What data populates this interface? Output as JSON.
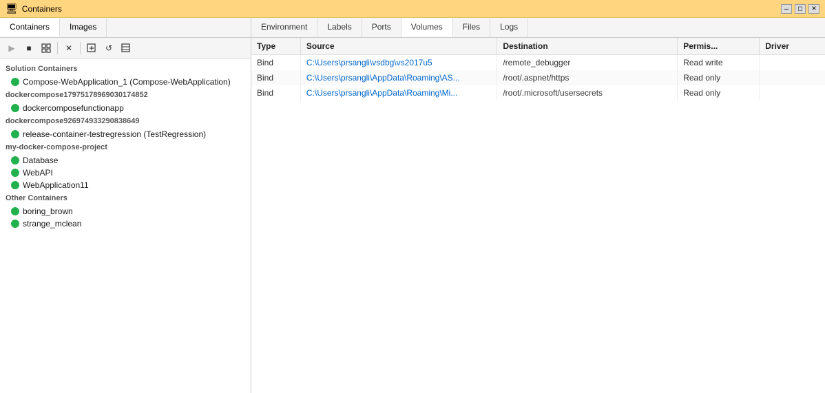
{
  "titleBar": {
    "title": "Containers",
    "controls": [
      "minimize",
      "restore",
      "close"
    ]
  },
  "leftPanel": {
    "tabs": [
      {
        "label": "Containers",
        "active": true
      },
      {
        "label": "Images",
        "active": false
      }
    ],
    "toolbar": {
      "buttons": [
        {
          "name": "play",
          "icon": "▶",
          "disabled": true
        },
        {
          "name": "stop",
          "icon": "■",
          "disabled": false
        },
        {
          "name": "attach",
          "icon": "⊞",
          "disabled": false
        },
        {
          "name": "delete",
          "icon": "✕",
          "disabled": false
        },
        {
          "name": "new",
          "icon": "⊡",
          "disabled": false
        },
        {
          "name": "refresh",
          "icon": "↺",
          "disabled": false
        },
        {
          "name": "more",
          "icon": "⊟",
          "disabled": false
        }
      ]
    },
    "groups": [
      {
        "name": "Solution Containers",
        "items": [
          {
            "label": "Compose-WebApplication_1 (Compose-WebApplication)",
            "running": true,
            "selected": false
          }
        ]
      },
      {
        "name": "dockercompose17975178969030174852",
        "items": [
          {
            "label": "dockercomposefunctionapp",
            "running": true,
            "selected": false
          }
        ]
      },
      {
        "name": "dockercompose9269749332908386​49",
        "items": [
          {
            "label": "release-container-testregression (TestRegression)",
            "running": true,
            "selected": false
          }
        ]
      },
      {
        "name": "my-docker-compose-project",
        "items": [
          {
            "label": "Database",
            "running": true,
            "selected": false
          },
          {
            "label": "WebAPI",
            "running": true,
            "selected": false
          },
          {
            "label": "WebApplication11",
            "running": true,
            "selected": false
          }
        ]
      },
      {
        "name": "Other Containers",
        "items": [
          {
            "label": "boring_brown",
            "running": true,
            "selected": false
          },
          {
            "label": "strange_mclean",
            "running": true,
            "selected": false
          }
        ]
      }
    ]
  },
  "rightPanel": {
    "tabs": [
      {
        "label": "Environment",
        "active": false
      },
      {
        "label": "Labels",
        "active": false
      },
      {
        "label": "Ports",
        "active": false
      },
      {
        "label": "Volumes",
        "active": true
      },
      {
        "label": "Files",
        "active": false
      },
      {
        "label": "Logs",
        "active": false
      }
    ],
    "table": {
      "columns": [
        {
          "label": "Type",
          "key": "type"
        },
        {
          "label": "Source",
          "key": "source"
        },
        {
          "label": "Destination",
          "key": "destination"
        },
        {
          "label": "Permis...",
          "key": "permissions"
        },
        {
          "label": "Driver",
          "key": "driver"
        }
      ],
      "rows": [
        {
          "type": "Bind",
          "source": "C:\\Users\\prsangli\\vsdbg\\vs2017u5",
          "sourceDisplay": "C:\\Users\\prsangli\\vsdbg\\vs2017u5",
          "destination": "/remote_debugger",
          "permissions": "Read write",
          "driver": "",
          "isLink": true
        },
        {
          "type": "Bind",
          "source": "C:\\Users\\prsangli\\AppData\\Roaming\\AS...",
          "sourceDisplay": "C:\\Users\\prsangli\\AppData\\Roaming\\AS...",
          "destination": "/root/.aspnet/https",
          "permissions": "Read only",
          "driver": "",
          "isLink": true
        },
        {
          "type": "Bind",
          "source": "C:\\Users\\prsangli\\AppData\\Roaming\\Mi...",
          "sourceDisplay": "C:\\Users\\prsangli\\AppData\\Roaming\\Mi...",
          "destination": "/root/.microsoft/usersecrets",
          "permissions": "Read only",
          "driver": "",
          "isLink": true
        }
      ]
    }
  }
}
